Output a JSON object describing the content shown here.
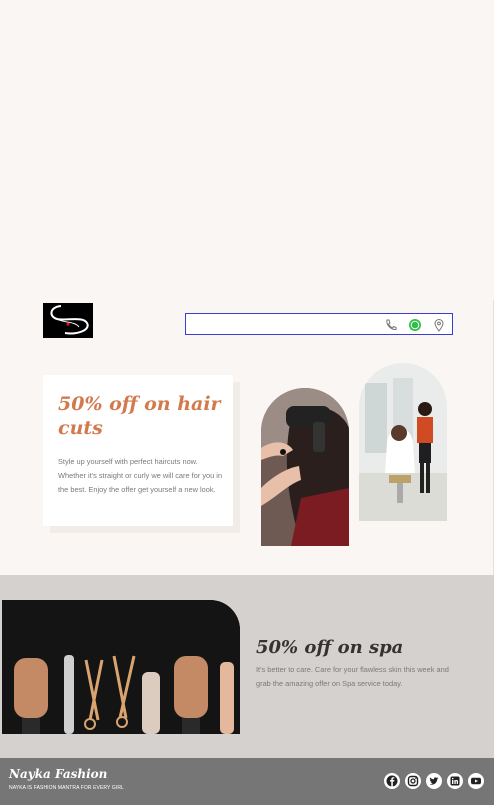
{
  "logo": {
    "alt": "Salon logo"
  },
  "contact": {
    "icons": [
      "phone-icon",
      "whatsapp-icon",
      "location-pin-icon"
    ]
  },
  "hair_offer": {
    "title": "50% off on hair cuts",
    "text": "Style up yourself with perfect haircuts now. Whether it's straight or curly we will care for you in the best. Enjoy the offer get yourself a new look."
  },
  "spa_offer": {
    "title": "50% off on spa",
    "text": "It's better to care. Care for your flawless skin this week and grab the amazing offer on Spa service today."
  },
  "footer": {
    "brand": "Nayka Fashion",
    "tagline": "NAYKA IS FASHION MANTRA FOR EVERY GIRL",
    "social": [
      "facebook-icon",
      "instagram-icon",
      "twitter-icon",
      "linkedin-icon",
      "youtube-icon"
    ]
  },
  "colors": {
    "accent": "#d27a4e",
    "footer_bg": "#767676",
    "spa_band": "#d5d1ce",
    "page_bg": "#faf6f3",
    "whatsapp": "#2fbf4a"
  }
}
